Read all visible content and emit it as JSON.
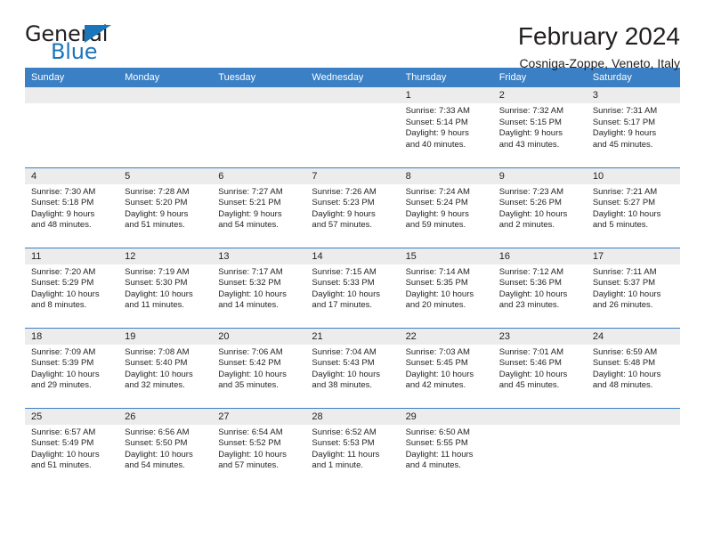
{
  "brand": {
    "name_part1": "General",
    "name_part2": "Blue",
    "accent_color": "#1b75bb"
  },
  "header": {
    "title": "February 2024",
    "subtitle": "Cosniga-Zoppe, Veneto, Italy"
  },
  "theme": {
    "header_row_bg": "#3b7fc4",
    "daynum_bg": "#ececec",
    "text_color": "#231f20"
  },
  "weekday_headers": [
    "Sunday",
    "Monday",
    "Tuesday",
    "Wednesday",
    "Thursday",
    "Friday",
    "Saturday"
  ],
  "weeks": [
    [
      {
        "day": ""
      },
      {
        "day": ""
      },
      {
        "day": ""
      },
      {
        "day": ""
      },
      {
        "day": "1",
        "sunrise": "Sunrise: 7:33 AM",
        "sunset": "Sunset: 5:14 PM",
        "daylight_line1": "Daylight: 9 hours",
        "daylight_line2": "and 40 minutes."
      },
      {
        "day": "2",
        "sunrise": "Sunrise: 7:32 AM",
        "sunset": "Sunset: 5:15 PM",
        "daylight_line1": "Daylight: 9 hours",
        "daylight_line2": "and 43 minutes."
      },
      {
        "day": "3",
        "sunrise": "Sunrise: 7:31 AM",
        "sunset": "Sunset: 5:17 PM",
        "daylight_line1": "Daylight: 9 hours",
        "daylight_line2": "and 45 minutes."
      }
    ],
    [
      {
        "day": "4",
        "sunrise": "Sunrise: 7:30 AM",
        "sunset": "Sunset: 5:18 PM",
        "daylight_line1": "Daylight: 9 hours",
        "daylight_line2": "and 48 minutes."
      },
      {
        "day": "5",
        "sunrise": "Sunrise: 7:28 AM",
        "sunset": "Sunset: 5:20 PM",
        "daylight_line1": "Daylight: 9 hours",
        "daylight_line2": "and 51 minutes."
      },
      {
        "day": "6",
        "sunrise": "Sunrise: 7:27 AM",
        "sunset": "Sunset: 5:21 PM",
        "daylight_line1": "Daylight: 9 hours",
        "daylight_line2": "and 54 minutes."
      },
      {
        "day": "7",
        "sunrise": "Sunrise: 7:26 AM",
        "sunset": "Sunset: 5:23 PM",
        "daylight_line1": "Daylight: 9 hours",
        "daylight_line2": "and 57 minutes."
      },
      {
        "day": "8",
        "sunrise": "Sunrise: 7:24 AM",
        "sunset": "Sunset: 5:24 PM",
        "daylight_line1": "Daylight: 9 hours",
        "daylight_line2": "and 59 minutes."
      },
      {
        "day": "9",
        "sunrise": "Sunrise: 7:23 AM",
        "sunset": "Sunset: 5:26 PM",
        "daylight_line1": "Daylight: 10 hours",
        "daylight_line2": "and 2 minutes."
      },
      {
        "day": "10",
        "sunrise": "Sunrise: 7:21 AM",
        "sunset": "Sunset: 5:27 PM",
        "daylight_line1": "Daylight: 10 hours",
        "daylight_line2": "and 5 minutes."
      }
    ],
    [
      {
        "day": "11",
        "sunrise": "Sunrise: 7:20 AM",
        "sunset": "Sunset: 5:29 PM",
        "daylight_line1": "Daylight: 10 hours",
        "daylight_line2": "and 8 minutes."
      },
      {
        "day": "12",
        "sunrise": "Sunrise: 7:19 AM",
        "sunset": "Sunset: 5:30 PM",
        "daylight_line1": "Daylight: 10 hours",
        "daylight_line2": "and 11 minutes."
      },
      {
        "day": "13",
        "sunrise": "Sunrise: 7:17 AM",
        "sunset": "Sunset: 5:32 PM",
        "daylight_line1": "Daylight: 10 hours",
        "daylight_line2": "and 14 minutes."
      },
      {
        "day": "14",
        "sunrise": "Sunrise: 7:15 AM",
        "sunset": "Sunset: 5:33 PM",
        "daylight_line1": "Daylight: 10 hours",
        "daylight_line2": "and 17 minutes."
      },
      {
        "day": "15",
        "sunrise": "Sunrise: 7:14 AM",
        "sunset": "Sunset: 5:35 PM",
        "daylight_line1": "Daylight: 10 hours",
        "daylight_line2": "and 20 minutes."
      },
      {
        "day": "16",
        "sunrise": "Sunrise: 7:12 AM",
        "sunset": "Sunset: 5:36 PM",
        "daylight_line1": "Daylight: 10 hours",
        "daylight_line2": "and 23 minutes."
      },
      {
        "day": "17",
        "sunrise": "Sunrise: 7:11 AM",
        "sunset": "Sunset: 5:37 PM",
        "daylight_line1": "Daylight: 10 hours",
        "daylight_line2": "and 26 minutes."
      }
    ],
    [
      {
        "day": "18",
        "sunrise": "Sunrise: 7:09 AM",
        "sunset": "Sunset: 5:39 PM",
        "daylight_line1": "Daylight: 10 hours",
        "daylight_line2": "and 29 minutes."
      },
      {
        "day": "19",
        "sunrise": "Sunrise: 7:08 AM",
        "sunset": "Sunset: 5:40 PM",
        "daylight_line1": "Daylight: 10 hours",
        "daylight_line2": "and 32 minutes."
      },
      {
        "day": "20",
        "sunrise": "Sunrise: 7:06 AM",
        "sunset": "Sunset: 5:42 PM",
        "daylight_line1": "Daylight: 10 hours",
        "daylight_line2": "and 35 minutes."
      },
      {
        "day": "21",
        "sunrise": "Sunrise: 7:04 AM",
        "sunset": "Sunset: 5:43 PM",
        "daylight_line1": "Daylight: 10 hours",
        "daylight_line2": "and 38 minutes."
      },
      {
        "day": "22",
        "sunrise": "Sunrise: 7:03 AM",
        "sunset": "Sunset: 5:45 PM",
        "daylight_line1": "Daylight: 10 hours",
        "daylight_line2": "and 42 minutes."
      },
      {
        "day": "23",
        "sunrise": "Sunrise: 7:01 AM",
        "sunset": "Sunset: 5:46 PM",
        "daylight_line1": "Daylight: 10 hours",
        "daylight_line2": "and 45 minutes."
      },
      {
        "day": "24",
        "sunrise": "Sunrise: 6:59 AM",
        "sunset": "Sunset: 5:48 PM",
        "daylight_line1": "Daylight: 10 hours",
        "daylight_line2": "and 48 minutes."
      }
    ],
    [
      {
        "day": "25",
        "sunrise": "Sunrise: 6:57 AM",
        "sunset": "Sunset: 5:49 PM",
        "daylight_line1": "Daylight: 10 hours",
        "daylight_line2": "and 51 minutes."
      },
      {
        "day": "26",
        "sunrise": "Sunrise: 6:56 AM",
        "sunset": "Sunset: 5:50 PM",
        "daylight_line1": "Daylight: 10 hours",
        "daylight_line2": "and 54 minutes."
      },
      {
        "day": "27",
        "sunrise": "Sunrise: 6:54 AM",
        "sunset": "Sunset: 5:52 PM",
        "daylight_line1": "Daylight: 10 hours",
        "daylight_line2": "and 57 minutes."
      },
      {
        "day": "28",
        "sunrise": "Sunrise: 6:52 AM",
        "sunset": "Sunset: 5:53 PM",
        "daylight_line1": "Daylight: 11 hours",
        "daylight_line2": "and 1 minute."
      },
      {
        "day": "29",
        "sunrise": "Sunrise: 6:50 AM",
        "sunset": "Sunset: 5:55 PM",
        "daylight_line1": "Daylight: 11 hours",
        "daylight_line2": "and 4 minutes."
      },
      {
        "day": ""
      },
      {
        "day": ""
      }
    ]
  ]
}
